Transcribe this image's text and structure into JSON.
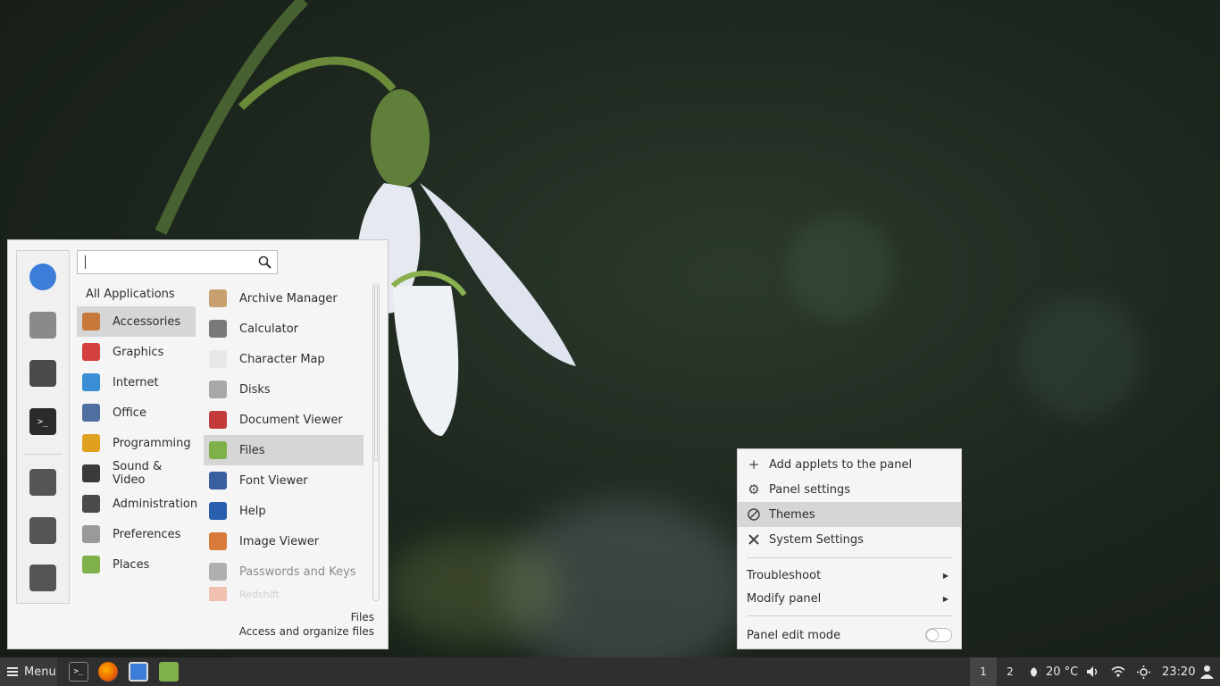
{
  "menu": {
    "search": {
      "value": "",
      "placeholder": ""
    },
    "favorites": [
      {
        "name": "chromium-icon",
        "color": "#3b7dd8"
      },
      {
        "name": "calculator-icon",
        "color": "#8a8a8a"
      },
      {
        "name": "system-settings-icon",
        "color": "#4a4a4a"
      },
      {
        "name": "terminal-icon",
        "color": "#2b2b2b"
      }
    ],
    "session_buttons": [
      {
        "name": "lock-screen-icon"
      },
      {
        "name": "logout-icon"
      },
      {
        "name": "power-icon"
      }
    ],
    "all_applications_label": "All Applications",
    "categories": [
      {
        "label": "Accessories",
        "icon": "accessories-icon",
        "color": "#c8783a",
        "selected": true
      },
      {
        "label": "Graphics",
        "icon": "graphics-icon",
        "color": "#d43f3f"
      },
      {
        "label": "Internet",
        "icon": "internet-icon",
        "color": "#3a8fd4"
      },
      {
        "label": "Office",
        "icon": "office-icon",
        "color": "#4f6fa0"
      },
      {
        "label": "Programming",
        "icon": "programming-icon",
        "color": "#e0a020"
      },
      {
        "label": "Sound & Video",
        "icon": "sound-video-icon",
        "color": "#3a3a3a"
      },
      {
        "label": "Administration",
        "icon": "administration-icon",
        "color": "#4a4a4a"
      },
      {
        "label": "Preferences",
        "icon": "preferences-icon",
        "color": "#9a9a9a"
      },
      {
        "label": "Places",
        "icon": "places-icon",
        "color": "#7fb04a"
      }
    ],
    "apps": [
      {
        "label": "Archive Manager",
        "icon": "archive-manager-icon",
        "color": "#c8a070"
      },
      {
        "label": "Calculator",
        "icon": "calculator-icon",
        "color": "#7a7a7a"
      },
      {
        "label": "Character Map",
        "icon": "character-map-icon",
        "color": "#e8e8e8"
      },
      {
        "label": "Disks",
        "icon": "disks-icon",
        "color": "#a8a8a8"
      },
      {
        "label": "Document Viewer",
        "icon": "document-viewer-icon",
        "color": "#c23a3a"
      },
      {
        "label": "Files",
        "icon": "files-icon",
        "color": "#7fb04a",
        "selected": true
      },
      {
        "label": "Font Viewer",
        "icon": "font-viewer-icon",
        "color": "#3a5fa0"
      },
      {
        "label": "Help",
        "icon": "help-icon",
        "color": "#2a5fb0"
      },
      {
        "label": "Image Viewer",
        "icon": "image-viewer-icon",
        "color": "#d87a3a"
      },
      {
        "label": "Passwords and Keys",
        "icon": "passwords-keys-icon",
        "color": "#b0b0b0",
        "dim": true
      },
      {
        "label": "Redshift",
        "icon": "redshift-icon",
        "color": "#f0c0b0",
        "faded": true
      }
    ],
    "description": {
      "title": "Files",
      "subtitle": "Access and organize files"
    }
  },
  "context_menu": {
    "items": [
      {
        "label": "Add applets to the panel",
        "icon": "plus-icon"
      },
      {
        "label": "Panel settings",
        "icon": "gear-icon"
      },
      {
        "label": "Themes",
        "icon": "themes-icon",
        "selected": true
      },
      {
        "label": "System Settings",
        "icon": "tools-icon"
      }
    ],
    "submenus": [
      {
        "label": "Troubleshoot"
      },
      {
        "label": "Modify panel"
      }
    ],
    "edit_mode_label": "Panel edit mode",
    "edit_mode_on": false
  },
  "panel": {
    "menu_label": "Menu",
    "launchers": [
      {
        "name": "terminal-launcher-icon",
        "color": "#2b2b2b"
      },
      {
        "name": "firefox-launcher-icon",
        "color": "#e66000"
      },
      {
        "name": "chromium-launcher-icon",
        "color": "#3b7dd8"
      },
      {
        "name": "files-launcher-icon",
        "color": "#7fb04a"
      }
    ],
    "workspaces": [
      "1",
      "2"
    ],
    "active_workspace": "1",
    "weather": "20 °C",
    "clock": "23:20"
  }
}
